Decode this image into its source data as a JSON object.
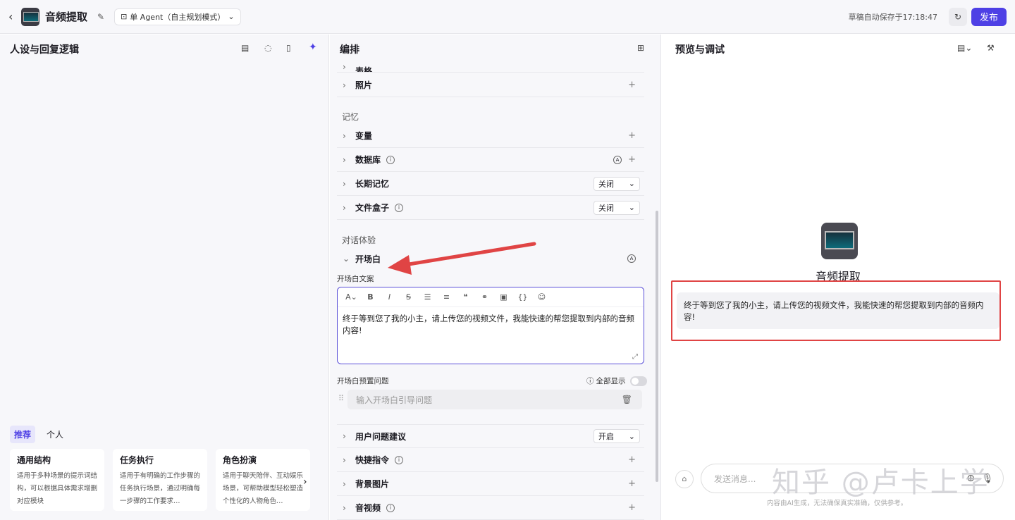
{
  "topbar": {
    "app_name": "音频提取",
    "mode_label": "单 Agent（自主规划模式）",
    "autosave": "草稿自动保存于17:18:47",
    "publish": "发布"
  },
  "left": {
    "title": "人设与回复逻辑",
    "tabs": [
      "推荐",
      "个人"
    ],
    "cards": [
      {
        "title": "通用结构",
        "desc": "适用于多种场景的提示词结构，可以根据具体需求增删对应模块"
      },
      {
        "title": "任务执行",
        "desc": "适用于有明确的工作步骤的任务执行场景，通过明确每一步骤的工作要求…"
      },
      {
        "title": "角色扮演",
        "desc": "适用于聊天陪伴、互动娱乐场景，可帮助模型轻松塑造个性化的人物角色…"
      }
    ]
  },
  "middle": {
    "title": "编排",
    "partial_top": "表格",
    "photo": "照片",
    "memory_section": "记忆",
    "variable": "变量",
    "database": "数据库",
    "long_memory": "长期记忆",
    "long_memory_value": "关闭",
    "file_box": "文件盒子",
    "file_box_value": "关闭",
    "dialog_section": "对话体验",
    "opening": "开场白",
    "opening_copy_label": "开场白文案",
    "opening_text": "终于等到您了我的小主，请上传您的视频文件，我能快速的帮您提取到内部的音频内容!",
    "preset_label": "开场白预置问题",
    "show_all": "全部显示",
    "preset_placeholder": "输入开场白引导问题",
    "user_suggest": "用户问题建议",
    "user_suggest_value": "开启",
    "shortcut": "快捷指令",
    "bg_image": "背景图片",
    "audio_video": "音视频"
  },
  "right": {
    "title": "预览与调试",
    "bot_name": "音频提取",
    "bot_message": "终于等到您了我的小主，请上传您的视频文件，我能快速的帮您提取到内部的音频内容!",
    "input_placeholder": "发送消息...",
    "disclaimer": "内容由AI生成，无法确保真实准确，仅供参考。"
  },
  "watermark": "知乎 @卢卡上学",
  "colors": {
    "accent": "#4e40e5",
    "annotation": "#e04444"
  }
}
